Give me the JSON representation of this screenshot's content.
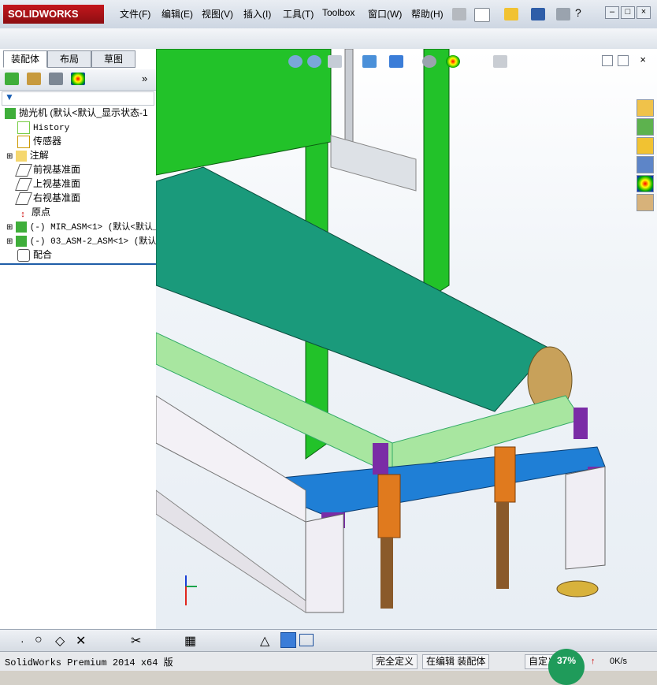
{
  "app": {
    "brand": "SOLIDWORKS"
  },
  "menu": [
    {
      "label": "文件(F)"
    },
    {
      "label": "编辑(E)"
    },
    {
      "label": "视图(V)"
    },
    {
      "label": "插入(I)"
    },
    {
      "label": "工具(T)"
    },
    {
      "label": "Toolbox"
    },
    {
      "label": "窗口(W)"
    },
    {
      "label": "帮助(H)"
    }
  ],
  "left_tabs": [
    "装配体",
    "布局",
    "草图"
  ],
  "tree": {
    "root": "抛光机  (默认<默认_显示状态-1",
    "items": [
      {
        "label": "History",
        "icon": "history-icon"
      },
      {
        "label": "传感器",
        "icon": "sensor-icon"
      },
      {
        "label": "注解",
        "icon": "annotation-icon"
      },
      {
        "label": "前视基准面",
        "icon": "plane-icon"
      },
      {
        "label": "上视基准面",
        "icon": "plane-icon"
      },
      {
        "label": "右视基准面",
        "icon": "plane-icon"
      },
      {
        "label": "原点",
        "icon": "origin-icon"
      },
      {
        "label": "(-) MIR_ASM<1> (默认<默认_",
        "icon": "assembly-icon"
      },
      {
        "label": "(-) 03_ASM-2_ASM<1> (默认<",
        "icon": "assembly-icon"
      },
      {
        "label": "配合",
        "icon": "mate-icon"
      }
    ]
  },
  "status": {
    "product": "SolidWorks Premium 2014 x64 版",
    "fully_defined": "完全定义",
    "editing": "在编辑 装配体",
    "custom": "自定义",
    "progress_percent": "37%",
    "speed": "0K/s"
  },
  "colors": {
    "green_panel": "#22c229",
    "belt": "#1a9a7b",
    "frame_light_green": "#a8e6a0",
    "plate_blue": "#1f7fd6",
    "bracket_purple": "#7a2ca6",
    "foot_orange": "#e07a1e",
    "leg_white": "#f0eef4"
  }
}
